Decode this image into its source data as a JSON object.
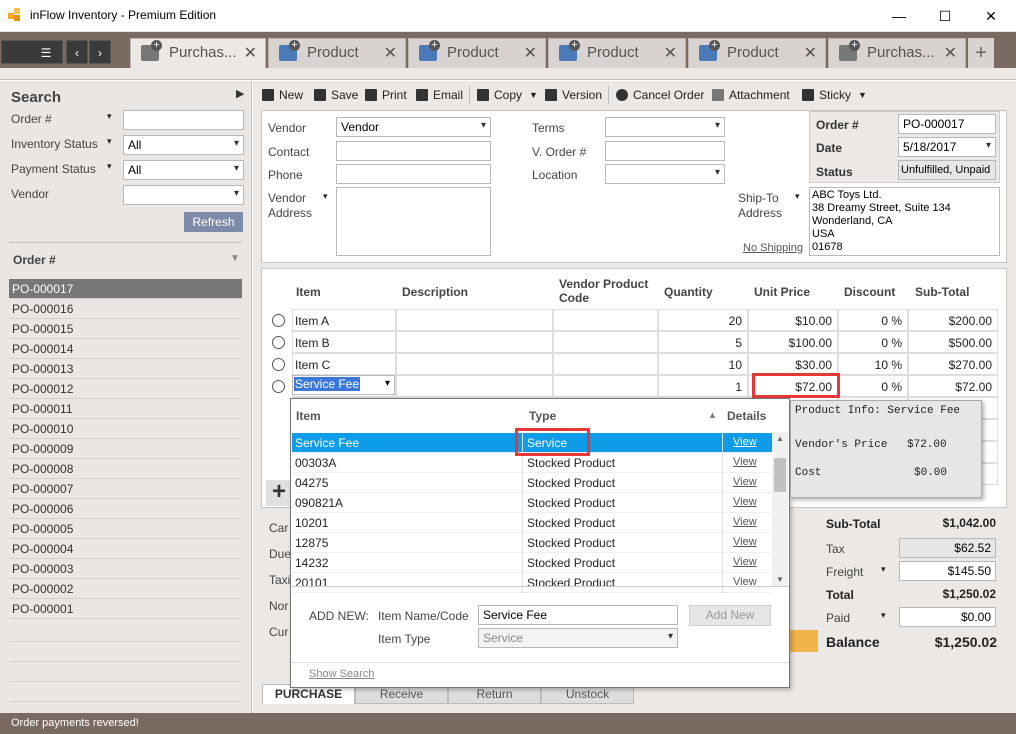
{
  "window": {
    "title": "inFlow Inventory - Premium Edition",
    "minimize": "—",
    "maximize": "☐",
    "close": "✕"
  },
  "tabs": [
    {
      "label": "Purchas...",
      "active": true,
      "icon": "purchase-order-icon"
    },
    {
      "label": "Product",
      "active": false,
      "icon": "product-icon"
    },
    {
      "label": "Product",
      "active": false,
      "icon": "product-icon"
    },
    {
      "label": "Product",
      "active": false,
      "icon": "product-icon"
    },
    {
      "label": "Product",
      "active": false,
      "icon": "product-icon"
    },
    {
      "label": "Purchas...",
      "active": false,
      "icon": "purchase-order-icon"
    }
  ],
  "tab_close": "✕",
  "tab_add": "+",
  "search": {
    "heading": "Search",
    "order_label": "Order #",
    "order_value": "",
    "inventory_status_label": "Inventory Status",
    "inventory_status_value": "All",
    "payment_status_label": "Payment Status",
    "payment_status_value": "All",
    "vendor_label": "Vendor",
    "vendor_value": "",
    "refresh": "Refresh",
    "list_header": "Order #",
    "orders": [
      "PO-000017",
      "PO-000016",
      "PO-000015",
      "PO-000014",
      "PO-000013",
      "PO-000012",
      "PO-000011",
      "PO-000010",
      "PO-000009",
      "PO-000008",
      "PO-000007",
      "PO-000006",
      "PO-000005",
      "PO-000004",
      "PO-000003",
      "PO-000002",
      "PO-000001"
    ]
  },
  "toolbar": {
    "new": "New",
    "save": "Save",
    "print": "Print",
    "email": "Email",
    "copy": "Copy",
    "version": "Version",
    "cancel_order": "Cancel Order",
    "attachment": "Attachment",
    "sticky": "Sticky"
  },
  "header": {
    "vendor_label": "Vendor",
    "vendor_value": "Vendor",
    "contact_label": "Contact",
    "contact_value": "",
    "phone_label": "Phone",
    "phone_value": "",
    "vendor_address_label": "Vendor\nAddress",
    "terms_label": "Terms",
    "terms_value": "",
    "vorder_label": "V. Order #",
    "vorder_value": "",
    "location_label": "Location",
    "location_value": "",
    "order_label": "Order #",
    "order_value": "PO-000017",
    "date_label": "Date",
    "date_value": "5/18/2017",
    "status_label": "Status",
    "status_value": "Unfulfilled, Unpaid",
    "shipto_label": "Ship-To\nAddress",
    "shipto_value": "ABC Toys Ltd.\n38 Dreamy Street, Suite 134\nWonderland, CA\nUSA\n01678",
    "no_shipping": "No Shipping"
  },
  "lines": {
    "columns": [
      "Item",
      "Description",
      "Vendor Product Code",
      "Quantity",
      "Unit Price",
      "Discount",
      "Sub-Total"
    ],
    "rows": [
      {
        "item": "Item A",
        "qty": "20",
        "price": "$10.00",
        "disc": "0 %",
        "sub": "$200.00"
      },
      {
        "item": "Item B",
        "qty": "5",
        "price": "$100.00",
        "disc": "0 %",
        "sub": "$500.00"
      },
      {
        "item": "Item C",
        "qty": "10",
        "price": "$30.00",
        "disc": "10 %",
        "sub": "$270.00"
      },
      {
        "item": "Service Fee",
        "qty": "1",
        "price": "$72.00",
        "disc": "0 %",
        "sub": "$72.00"
      }
    ]
  },
  "dropdown": {
    "col_item": "Item",
    "col_type": "Type",
    "col_details": "Details",
    "rows": [
      {
        "item": "Service Fee",
        "type": "Service",
        "details": "View"
      },
      {
        "item": "00303A",
        "type": "Stocked Product",
        "details": "View"
      },
      {
        "item": "04275",
        "type": "Stocked Product",
        "details": "View"
      },
      {
        "item": "090821A",
        "type": "Stocked Product",
        "details": "View"
      },
      {
        "item": "10201",
        "type": "Stocked Product",
        "details": "View"
      },
      {
        "item": "12875",
        "type": "Stocked Product",
        "details": "View"
      },
      {
        "item": "14232",
        "type": "Stocked Product",
        "details": "View"
      },
      {
        "item": "20101",
        "type": "Stocked Product",
        "details": "View"
      }
    ],
    "add_new_label": "ADD NEW:",
    "item_name_label": "Item Name/Code",
    "item_name_value": "Service Fee",
    "add_new_button": "Add New",
    "item_type_label": "Item Type",
    "item_type_value": "Service",
    "show_search": "Show Search"
  },
  "product_info": {
    "title": "Product Info: Service Fee",
    "vendor_price_label": "Vendor's Price",
    "vendor_price_value": "$72.00",
    "cost_label": "Cost",
    "cost_value": "$0.00"
  },
  "left_fields": [
    "Car",
    "Due",
    "Taxi",
    "Nor",
    "Cur"
  ],
  "totals": {
    "subtotal_label": "Sub-Total",
    "subtotal": "$1,042.00",
    "tax_label": "Tax",
    "tax": "$62.52",
    "freight_label": "Freight",
    "freight": "$145.50",
    "total_label": "Total",
    "total": "$1,250.02",
    "paid_label": "Paid",
    "paid": "$0.00",
    "balance_label": "Balance",
    "balance": "$1,250.02"
  },
  "bottom_tabs": [
    "PURCHASE",
    "Receive",
    "Return",
    "Unstock"
  ],
  "status": "Order payments reversed!"
}
